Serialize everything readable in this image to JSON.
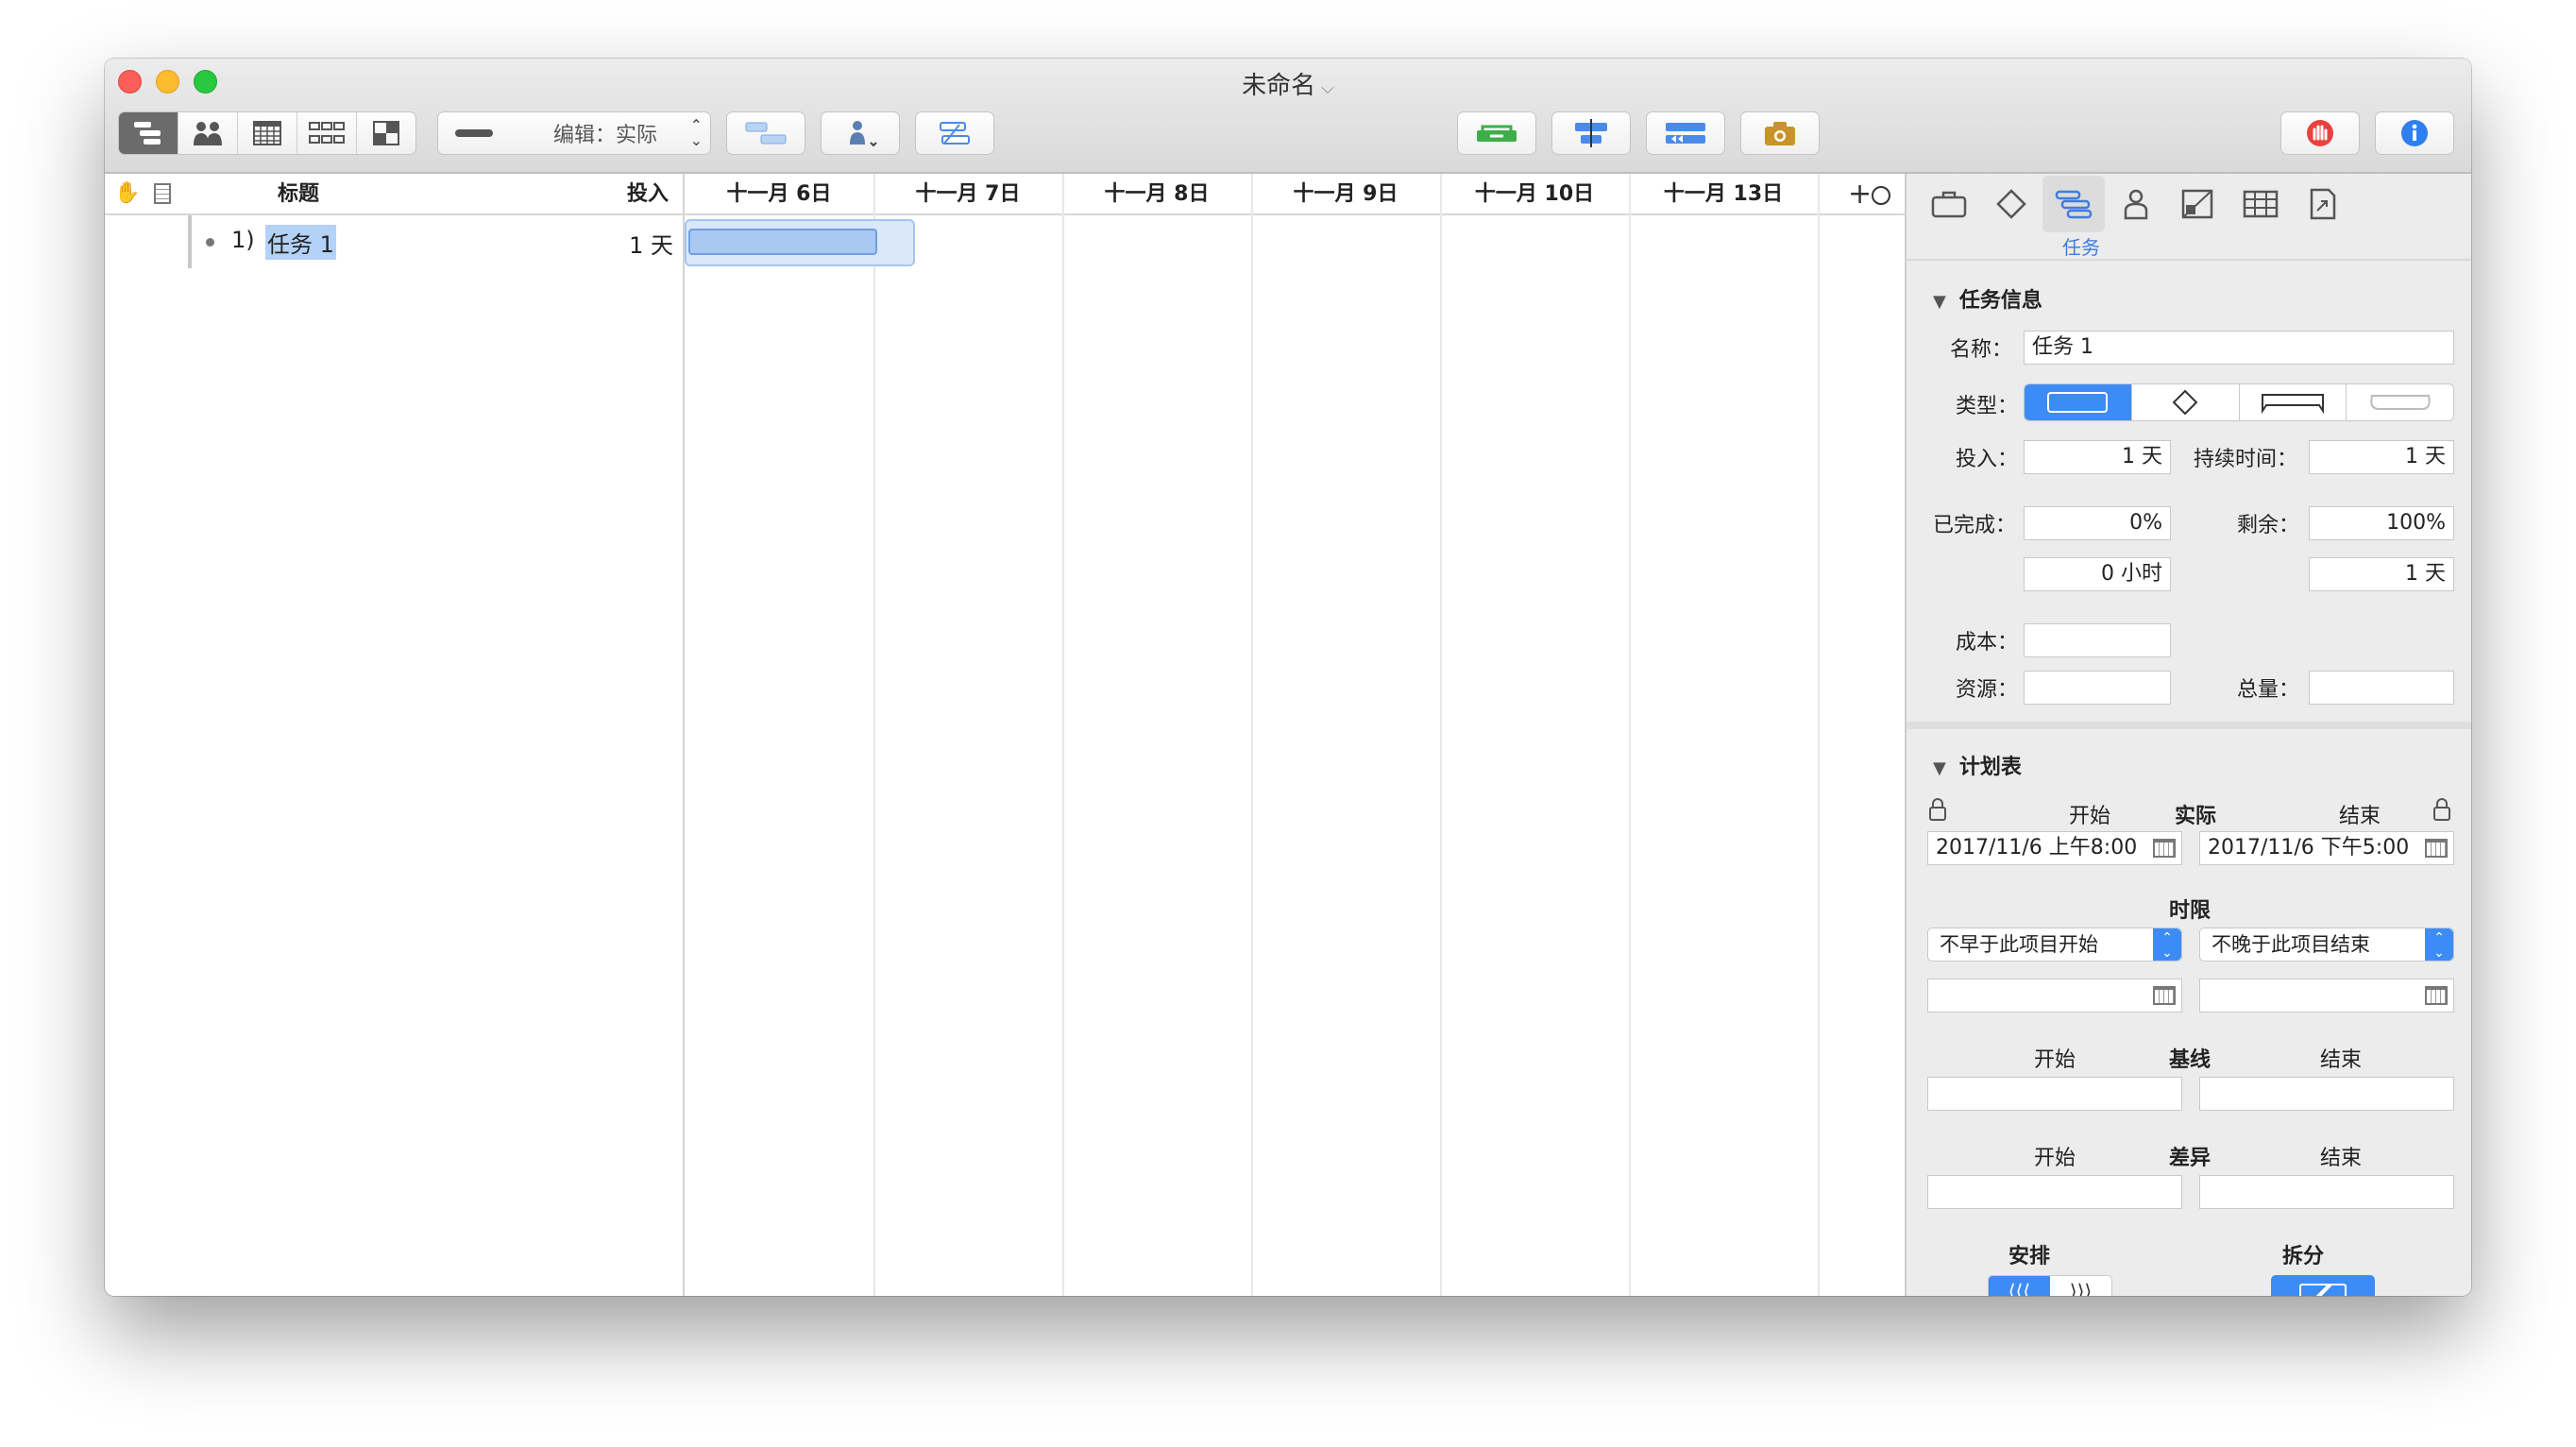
{
  "window": {
    "title": "未命名"
  },
  "toolbar": {
    "edit_mode_label": "编辑：实际"
  },
  "outline": {
    "col_title": "标题",
    "col_effort": "投入",
    "rows": [
      {
        "number": "1)",
        "title": "任务 1",
        "effort": "1 天"
      }
    ]
  },
  "gantt": {
    "dates": [
      "十一月 6日",
      "十一月 7日",
      "十一月 8日",
      "十一月 9日",
      "十一月 10日",
      "十一月 13日"
    ],
    "zoom_label": "+"
  },
  "inspector": {
    "active_tab_label": "任务",
    "task_info": {
      "header": "任务信息",
      "name_label": "名称：",
      "name_value": "任务 1",
      "type_label": "类型：",
      "effort_label": "投入：",
      "effort_value": "1 天",
      "duration_label": "持续时间：",
      "duration_value": "1 天",
      "complete_label": "已完成：",
      "complete_value": "0%",
      "remaining_label": "剩余：",
      "remaining_value": "100%",
      "complete_hours": "0 小时",
      "remaining_days": "1 天",
      "cost_label": "成本：",
      "cost_value": "",
      "resource_label": "资源：",
      "resource_value": "",
      "total_label": "总量：",
      "total_value": ""
    },
    "schedule": {
      "header": "计划表",
      "start_label": "开始",
      "actual_label": "实际",
      "end_label": "结束",
      "start_value": "2017/11/6 上午8:00",
      "end_value": "2017/11/6 下午5:00",
      "deadline_label": "时限",
      "deadline_start_option": "不早于此项目开始",
      "deadline_end_option": "不晚于此项目结束",
      "baseline_label": "基线",
      "variance_label": "差异",
      "leveling_label": "安排",
      "split_label": "拆分"
    }
  },
  "colors": {
    "accent": "#3d8cf5",
    "gantt_bar": "#a9c8f2",
    "selection": "#b4d2f7"
  }
}
